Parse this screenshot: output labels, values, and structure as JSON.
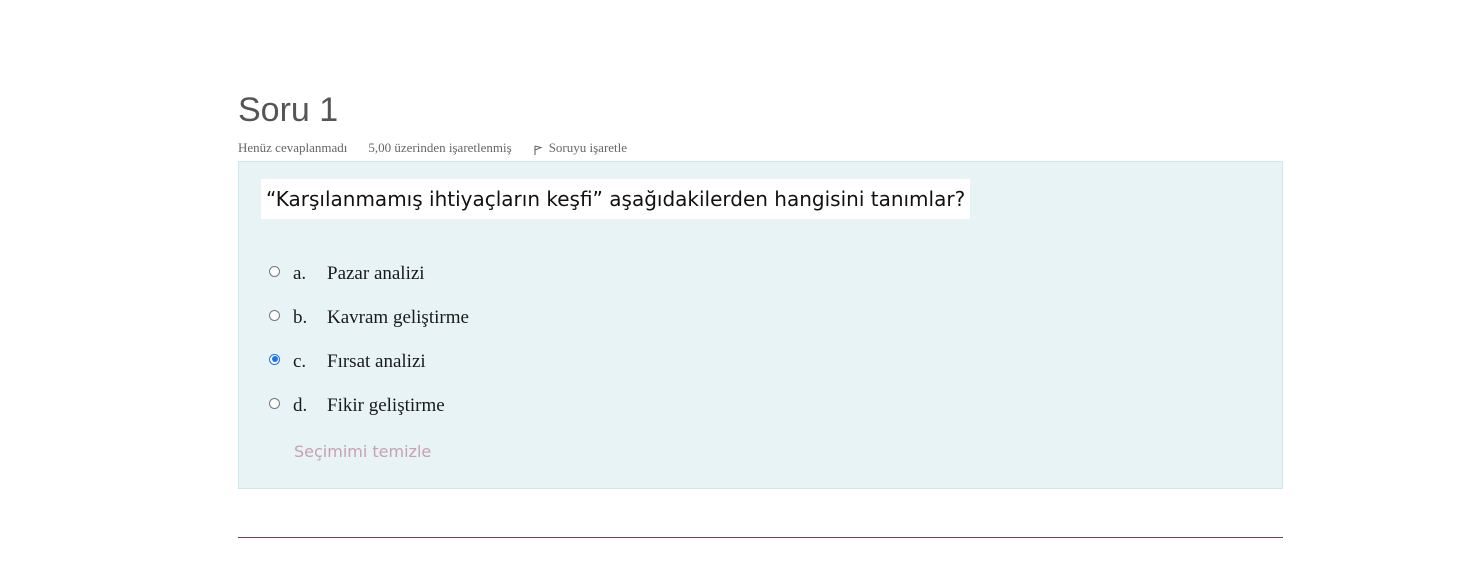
{
  "question": {
    "title": "Soru 1",
    "state": "Henüz cevaplanmadı",
    "grade": "5,00 üzerinden işaretlenmiş",
    "flag_label": "Soruyu işaretle",
    "text": "“Karşılanmamış ihtiyaçların keşfi” aşağıdakilerden hangisini tanımlar?",
    "answers": [
      {
        "number": "a.",
        "label": "Pazar analizi",
        "selected": false
      },
      {
        "number": "b.",
        "label": "Kavram geliştirme",
        "selected": false
      },
      {
        "number": "c.",
        "label": "Fırsat analizi",
        "selected": true
      },
      {
        "number": "d.",
        "label": "Fikir geliştirme",
        "selected": false
      }
    ],
    "clear_label": "Seçimimi temizle"
  },
  "icons": {
    "flag": "flag-icon"
  },
  "colors": {
    "panel_background": "#e7f3f5",
    "selected_radio": "#1a73e8",
    "clear_link": "#c8a0b4",
    "divider": "#7a3b57"
  }
}
